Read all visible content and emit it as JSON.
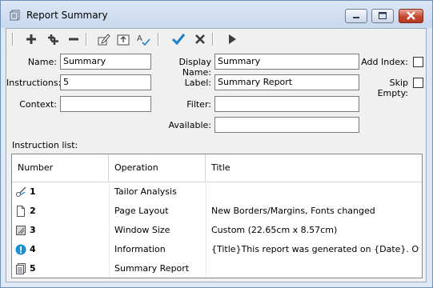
{
  "window": {
    "title": "Report Summary",
    "title_icon": "report-icon"
  },
  "toolbar": {
    "items": [
      "add-icon",
      "add-multiple-icon",
      "remove-icon",
      "edit-icon",
      "move-up-icon",
      "spell-check-icon",
      "apply-checkmark-icon",
      "cancel-x-icon",
      "run-play-icon"
    ]
  },
  "form": {
    "name_label": "Name:",
    "name_value": "Summary",
    "instructions_label": "Instructions:",
    "instructions_value": "5",
    "context_label": "Context:",
    "context_value": "",
    "display_name_label": "Display Name:",
    "display_name_value": "Summary",
    "label_label": "Label:",
    "label_value": "Summary Report",
    "filter_label": "Filter:",
    "filter_value": "",
    "available_label": "Available:",
    "available_value": "",
    "add_index_label": "Add Index:",
    "add_index_checked": false,
    "skip_empty_label": "Skip Empty:",
    "skip_empty_checked": false
  },
  "instruction_list": {
    "label": "Instruction list:",
    "columns": [
      "Number",
      "Operation",
      "Title"
    ],
    "rows": [
      {
        "number": "1",
        "operation": "Tailor Analysis",
        "title": "",
        "icon": "tailor-analysis-icon"
      },
      {
        "number": "2",
        "operation": "Page Layout",
        "title": "New Borders/Margins, Fonts changed",
        "icon": "page-icon"
      },
      {
        "number": "3",
        "operation": "Window Size",
        "title": "Custom (22.65cm x 8.57cm)",
        "icon": "window-size-icon"
      },
      {
        "number": "4",
        "operation": "Information",
        "title": "{Title}This report was generated on {Date}. Overall ...",
        "icon": "info-icon"
      },
      {
        "number": "5",
        "operation": "Summary Report",
        "title": "",
        "icon": "report-icon"
      }
    ]
  },
  "colors": {
    "accent_check": "#1e7ec8",
    "info_icon": "#1a8fd6",
    "close_button": "#c6482f"
  }
}
